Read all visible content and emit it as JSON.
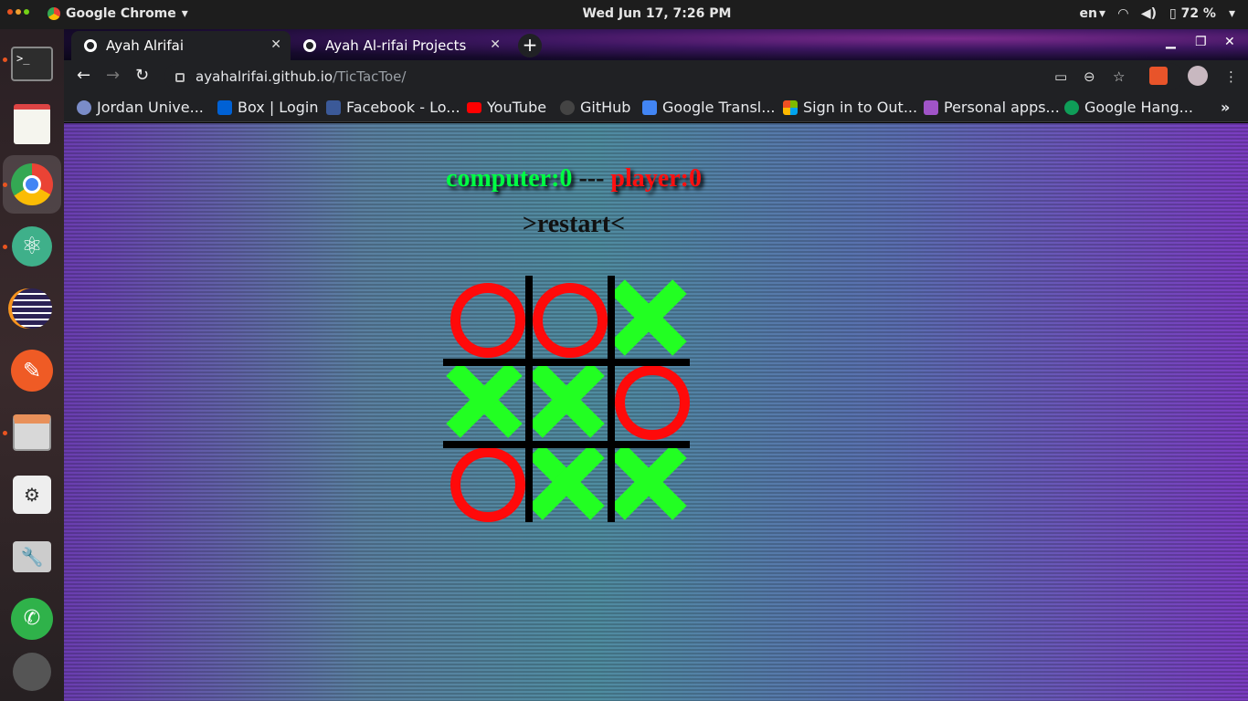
{
  "system": {
    "app_name": "Google Chrome",
    "clock": "Wed Jun 17,  7:26 PM",
    "language": "en",
    "battery": "72 %"
  },
  "tabs": [
    {
      "title": "Ayah Alrifai",
      "active": true
    },
    {
      "title": "Ayah Al-rifai Projects",
      "active": false
    }
  ],
  "address": {
    "host": "ayahalrifai.github.io",
    "path": "/TicTacToe/"
  },
  "bookmarks": [
    {
      "label": "Jordan Unive...",
      "icon": "ju-icon",
      "color": "#7a8cc8"
    },
    {
      "label": "Box | Login",
      "icon": "box-icon",
      "color": "#0061d5"
    },
    {
      "label": "Facebook - Lo...",
      "icon": "facebook-icon",
      "color": "#3b5998"
    },
    {
      "label": "YouTube",
      "icon": "youtube-icon",
      "color": "#ff0000"
    },
    {
      "label": "GitHub",
      "icon": "github-icon",
      "color": "#444444"
    },
    {
      "label": "Google Transl...",
      "icon": "translate-icon",
      "color": "#4285f4"
    },
    {
      "label": "Sign in to Out...",
      "icon": "microsoft-icon",
      "color": "#f25022"
    },
    {
      "label": "Personal apps...",
      "icon": "h-icon",
      "color": "#a054c8"
    },
    {
      "label": "Google Hang...",
      "icon": "hangouts-icon",
      "color": "#0f9d58"
    }
  ],
  "game": {
    "computer_label": "computer:0",
    "separator": " --- ",
    "player_label": "player:0",
    "restart_label": ">restart<",
    "board": [
      "O",
      "O",
      "X",
      "X",
      "X",
      "O",
      "O",
      "X",
      "X"
    ],
    "colors": {
      "o": "#ff0a0a",
      "x": "#22ff22"
    }
  }
}
